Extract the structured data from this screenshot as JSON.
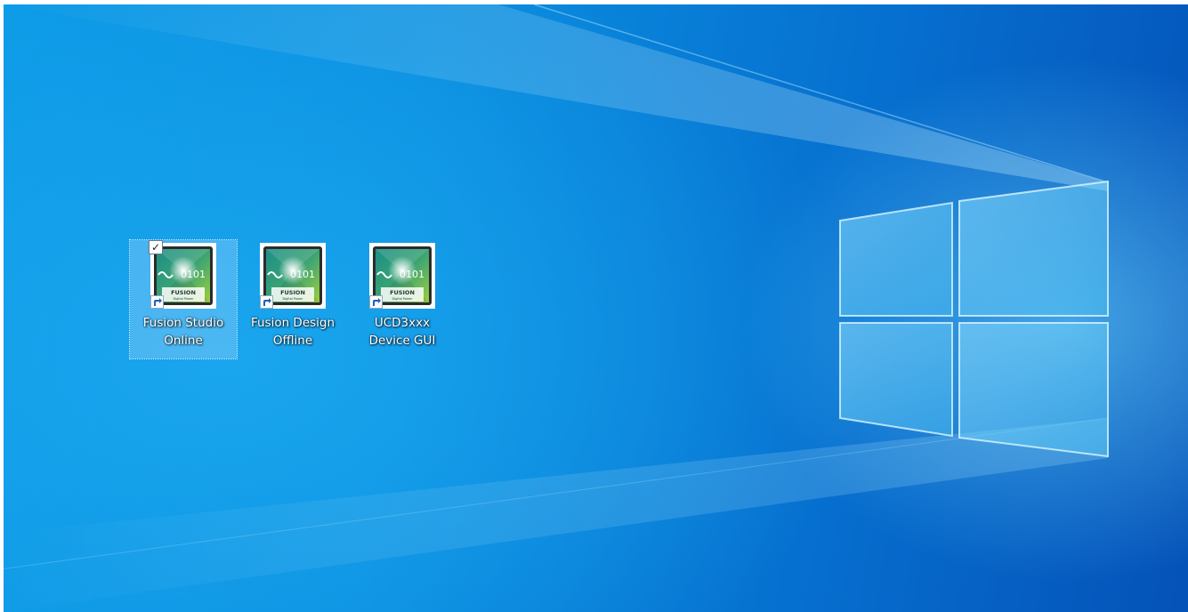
{
  "desktop": {
    "icons": [
      {
        "label_line1": "Fusion Studio",
        "label_line2": "Online",
        "icon": "fusion-digital-power-icon",
        "shortcut": true,
        "selected": true,
        "checked": true
      },
      {
        "label_line1": "Fusion Design",
        "label_line2": "Offline",
        "icon": "fusion-digital-power-icon",
        "shortcut": true,
        "selected": false,
        "checked": false
      },
      {
        "label_line1": "UCD3xxx",
        "label_line2": "Device GUI",
        "icon": "fusion-digital-power-icon",
        "shortcut": true,
        "selected": false,
        "checked": false
      }
    ],
    "icon_art": {
      "digits": "0101",
      "brand": "FUSION",
      "subtitle": "Digital Power"
    },
    "check_glyph": "✓",
    "wallpaper": "windows-10-hero-logo",
    "colors": {
      "background_light": "#1aa6ee",
      "background_dark": "#0552b8",
      "icon_green": "#6fbf3a",
      "icon_teal": "#1c8f86",
      "label_text": "#ffffff"
    }
  }
}
